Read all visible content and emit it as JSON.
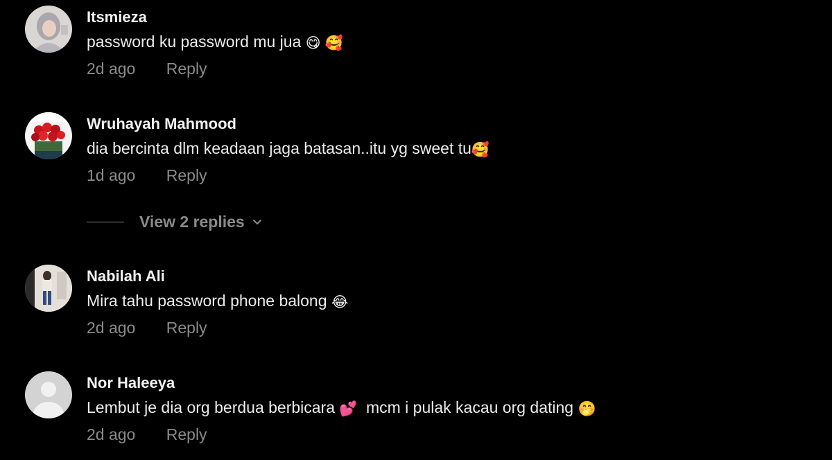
{
  "comments": [
    {
      "username": "Itsmieza",
      "text": "password ku password mu jua",
      "emojis": "😋 🥰",
      "time": "2d ago",
      "reply_label": "Reply",
      "avatar": "avatar-hijab-photo"
    },
    {
      "username": "Wruhayah Mahmood",
      "text": "dia bercinta dlm keadaan jaga batasan..itu yg sweet tu",
      "emojis": "🥰",
      "time": "1d ago",
      "reply_label": "Reply",
      "avatar": "avatar-roses-photo"
    },
    {
      "username": "Nabilah Ali",
      "text": "Mira tahu password phone balong",
      "emojis": "😂",
      "time": "2d ago",
      "reply_label": "Reply",
      "avatar": "avatar-person-photo"
    },
    {
      "username": "Nor Haleeya",
      "text": "Lembut je dia org berdua berbicara",
      "emojis": "💕",
      "text2": "mcm i pulak kacau org dating",
      "emojis2": "🤭",
      "time": "2d ago",
      "reply_label": "Reply",
      "avatar": "avatar-default-icon"
    }
  ],
  "view_replies": {
    "label": "View 2 replies",
    "icon": "chevron-down-icon"
  },
  "colors": {
    "background": "#000000",
    "username": "#f2f2f2",
    "text": "#ececec",
    "muted": "#8a8a8a"
  }
}
